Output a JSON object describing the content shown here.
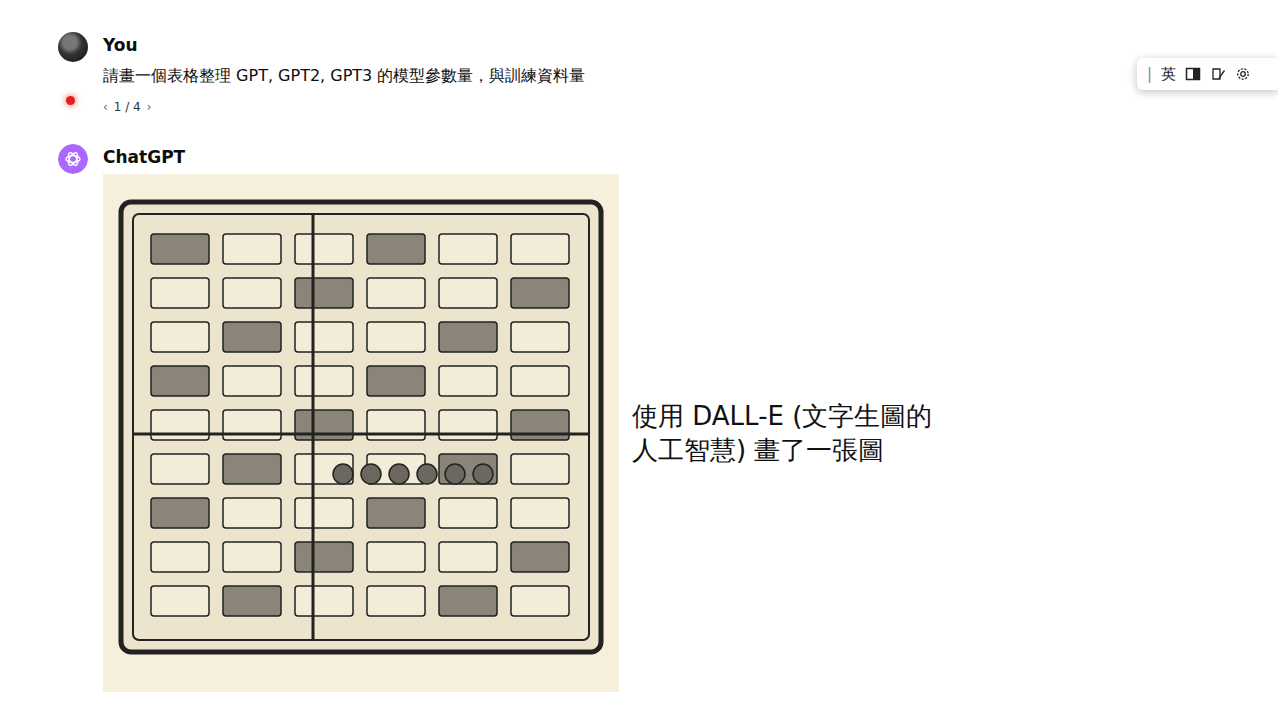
{
  "user": {
    "name": "You",
    "message": "請畫一個表格整理 GPT, GPT2, GPT3 的模型參數量，與訓練資料量",
    "pager": {
      "prev": "‹",
      "position": "1 / 4",
      "next": "›"
    }
  },
  "assistant": {
    "name": "ChatGPT"
  },
  "annotation": [
    "使用 DALL-E (文字生圖的",
    "人工智慧) 畫了一張圖"
  ],
  "ime_toolbar": {
    "items": [
      "|",
      "英"
    ]
  }
}
